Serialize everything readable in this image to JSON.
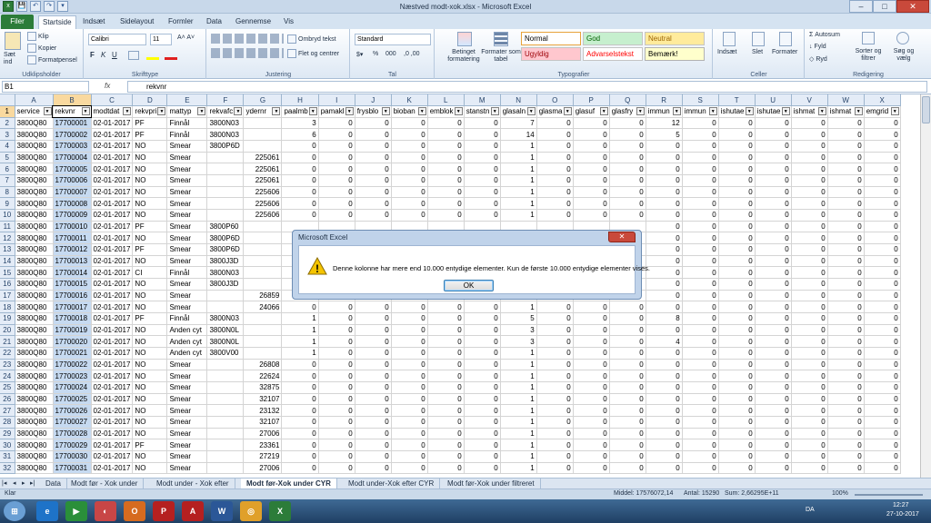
{
  "window": {
    "title": "Næstved modt-xok.xlsx - Microsoft Excel",
    "qat": [
      "x",
      "💾",
      "↶",
      "↷",
      "▾"
    ],
    "controls": {
      "minimize": "–",
      "maximize": "□",
      "close": "✕"
    }
  },
  "ribbon_tabs": {
    "file": "Filer",
    "tabs": [
      "Startside",
      "Indsæt",
      "Sidelayout",
      "Formler",
      "Data",
      "Gennemse",
      "Vis"
    ]
  },
  "ribbon": {
    "clipboard": {
      "paste": "Sæt ind",
      "cut": "Klip",
      "copy": "Kopier",
      "format_painter": "Formatpensel",
      "label": "Udklipsholder"
    },
    "font": {
      "name": "Calibri",
      "size": "11",
      "label": "Skrifttype",
      "bold": "F",
      "italic": "K",
      "underline": "U"
    },
    "alignment": {
      "wrap": "Ombryd tekst",
      "merge": "Flet og centrer",
      "label": "Justering"
    },
    "number": {
      "format": "Standard",
      "label": "Tal",
      "percent": "%",
      "thousands": "000"
    },
    "styles": {
      "cond_format": "Betinget formatering",
      "table_format": "Formater som tabel",
      "normal": "Normal",
      "good": "God",
      "neutral": "Neutral",
      "bad": "Ugyldig",
      "warning": "Advarselstekst",
      "note": "Bemærk!",
      "label": "Typografier"
    },
    "cells": {
      "insert": "Indsæt",
      "delete": "Slet",
      "format": "Formater",
      "label": "Celler"
    },
    "editing": {
      "autosum": "Autosum",
      "fill": "Fyld",
      "clear": "Ryd",
      "sort": "Sorter og filtrer",
      "find": "Søg og vælg",
      "label": "Redigering"
    }
  },
  "formula_bar": {
    "name_box": "B1",
    "fx": "fx",
    "content": "rekvnr"
  },
  "grid": {
    "columns": [
      "A",
      "B",
      "C",
      "D",
      "E",
      "F",
      "G",
      "H",
      "I",
      "J",
      "K",
      "L",
      "M",
      "N",
      "O",
      "P",
      "Q",
      "R",
      "S",
      "T",
      "U",
      "V",
      "W",
      "X"
    ],
    "header_row": [
      "service",
      "rekvnr",
      "modtdat",
      "rekvpri",
      "mattyp",
      "rekvafc",
      "ydernr",
      "paalmb",
      "pamakl",
      "frysblo",
      "bioban",
      "emblok",
      "stanstn",
      "glasaln",
      "glasma",
      "glasuf",
      "glasfry",
      "immun",
      "immun",
      "ishutae",
      "ishutae",
      "ishmat",
      "ishmat",
      "emgrid"
    ],
    "rows": [
      [
        "3800Q80",
        "17700001",
        "02-01-2017",
        "PF",
        "Finnål",
        "3800N03",
        "",
        "3",
        "0",
        "0",
        "0",
        "0",
        "0",
        "7",
        "0",
        "0",
        "0",
        "12",
        "0",
        "0",
        "0",
        "0",
        "0",
        "0"
      ],
      [
        "3800Q80",
        "17700002",
        "02-01-2017",
        "PF",
        "Finnål",
        "3800N03",
        "",
        "6",
        "0",
        "0",
        "0",
        "0",
        "0",
        "14",
        "0",
        "0",
        "0",
        "5",
        "0",
        "0",
        "0",
        "0",
        "0",
        "0"
      ],
      [
        "3800Q80",
        "17700003",
        "02-01-2017",
        "NO",
        "Smear",
        "3800P6D",
        "",
        "0",
        "0",
        "0",
        "0",
        "0",
        "0",
        "1",
        "0",
        "0",
        "0",
        "0",
        "0",
        "0",
        "0",
        "0",
        "0",
        "0"
      ],
      [
        "3800Q80",
        "17700004",
        "02-01-2017",
        "NO",
        "Smear",
        "",
        "225061",
        "0",
        "0",
        "0",
        "0",
        "0",
        "0",
        "1",
        "0",
        "0",
        "0",
        "0",
        "0",
        "0",
        "0",
        "0",
        "0",
        "0"
      ],
      [
        "3800Q80",
        "17700005",
        "02-01-2017",
        "NO",
        "Smear",
        "",
        "225061",
        "0",
        "0",
        "0",
        "0",
        "0",
        "0",
        "1",
        "0",
        "0",
        "0",
        "0",
        "0",
        "0",
        "0",
        "0",
        "0",
        "0"
      ],
      [
        "3800Q80",
        "17700006",
        "02-01-2017",
        "NO",
        "Smear",
        "",
        "225061",
        "0",
        "0",
        "0",
        "0",
        "0",
        "0",
        "1",
        "0",
        "0",
        "0",
        "0",
        "0",
        "0",
        "0",
        "0",
        "0",
        "0"
      ],
      [
        "3800Q80",
        "17700007",
        "02-01-2017",
        "NO",
        "Smear",
        "",
        "225606",
        "0",
        "0",
        "0",
        "0",
        "0",
        "0",
        "1",
        "0",
        "0",
        "0",
        "0",
        "0",
        "0",
        "0",
        "0",
        "0",
        "0"
      ],
      [
        "3800Q80",
        "17700008",
        "02-01-2017",
        "NO",
        "Smear",
        "",
        "225606",
        "0",
        "0",
        "0",
        "0",
        "0",
        "0",
        "1",
        "0",
        "0",
        "0",
        "0",
        "0",
        "0",
        "0",
        "0",
        "0",
        "0"
      ],
      [
        "3800Q80",
        "17700009",
        "02-01-2017",
        "NO",
        "Smear",
        "",
        "225606",
        "0",
        "0",
        "0",
        "0",
        "0",
        "0",
        "1",
        "0",
        "0",
        "0",
        "0",
        "0",
        "0",
        "0",
        "0",
        "0",
        "0"
      ],
      [
        "3800Q80",
        "17700010",
        "02-01-2017",
        "PF",
        "Smear",
        "3800P60",
        "",
        "",
        "",
        "",
        "",
        "",
        "",
        "",
        "",
        "",
        "",
        "0",
        "0",
        "0",
        "0",
        "0",
        "0",
        "0"
      ],
      [
        "3800Q80",
        "17700011",
        "02-01-2017",
        "NO",
        "Smear",
        "3800P6D",
        "",
        "",
        "",
        "",
        "",
        "",
        "",
        "",
        "",
        "",
        "",
        "0",
        "0",
        "0",
        "0",
        "0",
        "0",
        "0"
      ],
      [
        "3800Q80",
        "17700012",
        "02-01-2017",
        "PF",
        "Smear",
        "3800P6D",
        "",
        "",
        "",
        "",
        "",
        "",
        "",
        "",
        "",
        "",
        "",
        "0",
        "0",
        "0",
        "0",
        "0",
        "0",
        "0"
      ],
      [
        "3800Q80",
        "17700013",
        "02-01-2017",
        "NO",
        "Smear",
        "3800J3D",
        "",
        "",
        "",
        "",
        "",
        "",
        "",
        "",
        "",
        "",
        "",
        "0",
        "0",
        "0",
        "0",
        "0",
        "0",
        "0"
      ],
      [
        "3800Q80",
        "17700014",
        "02-01-2017",
        "CI",
        "Finnål",
        "3800N03",
        "",
        "",
        "",
        "",
        "",
        "",
        "",
        "",
        "",
        "",
        "",
        "0",
        "0",
        "0",
        "0",
        "0",
        "0",
        "0"
      ],
      [
        "3800Q80",
        "17700015",
        "02-01-2017",
        "NO",
        "Smear",
        "3800J3D",
        "",
        "",
        "",
        "",
        "",
        "",
        "",
        "",
        "",
        "",
        "",
        "0",
        "0",
        "0",
        "0",
        "0",
        "0",
        "0"
      ],
      [
        "3800Q80",
        "17700016",
        "02-01-2017",
        "NO",
        "Smear",
        "",
        "26859",
        "",
        "",
        "",
        "",
        "",
        "",
        "",
        "",
        "",
        "",
        "0",
        "0",
        "0",
        "0",
        "0",
        "0",
        "0"
      ],
      [
        "3800Q80",
        "17700017",
        "02-01-2017",
        "NO",
        "Smear",
        "",
        "24066",
        "0",
        "0",
        "0",
        "0",
        "0",
        "0",
        "1",
        "0",
        "0",
        "0",
        "0",
        "0",
        "0",
        "0",
        "0",
        "0",
        "0"
      ],
      [
        "3800Q80",
        "17700018",
        "02-01-2017",
        "PF",
        "Finnål",
        "3800N03",
        "",
        "1",
        "0",
        "0",
        "0",
        "0",
        "0",
        "5",
        "0",
        "0",
        "0",
        "8",
        "0",
        "0",
        "0",
        "0",
        "0",
        "0"
      ],
      [
        "3800Q80",
        "17700019",
        "02-01-2017",
        "NO",
        "Anden cyt",
        "3800N0L",
        "",
        "1",
        "0",
        "0",
        "0",
        "0",
        "0",
        "3",
        "0",
        "0",
        "0",
        "0",
        "0",
        "0",
        "0",
        "0",
        "0",
        "0"
      ],
      [
        "3800Q80",
        "17700020",
        "02-01-2017",
        "NO",
        "Anden cyt",
        "3800N0L",
        "",
        "1",
        "0",
        "0",
        "0",
        "0",
        "0",
        "3",
        "0",
        "0",
        "0",
        "4",
        "0",
        "0",
        "0",
        "0",
        "0",
        "0"
      ],
      [
        "3800Q80",
        "17700021",
        "02-01-2017",
        "NO",
        "Anden cyt",
        "3800V00",
        "",
        "1",
        "0",
        "0",
        "0",
        "0",
        "0",
        "1",
        "0",
        "0",
        "0",
        "0",
        "0",
        "0",
        "0",
        "0",
        "0",
        "0"
      ],
      [
        "3800Q80",
        "17700022",
        "02-01-2017",
        "NO",
        "Smear",
        "",
        "26808",
        "0",
        "0",
        "0",
        "0",
        "0",
        "0",
        "1",
        "0",
        "0",
        "0",
        "0",
        "0",
        "0",
        "0",
        "0",
        "0",
        "0"
      ],
      [
        "3800Q80",
        "17700023",
        "02-01-2017",
        "NO",
        "Smear",
        "",
        "22624",
        "0",
        "0",
        "0",
        "0",
        "0",
        "0",
        "1",
        "0",
        "0",
        "0",
        "0",
        "0",
        "0",
        "0",
        "0",
        "0",
        "0"
      ],
      [
        "3800Q80",
        "17700024",
        "02-01-2017",
        "NO",
        "Smear",
        "",
        "32875",
        "0",
        "0",
        "0",
        "0",
        "0",
        "0",
        "1",
        "0",
        "0",
        "0",
        "0",
        "0",
        "0",
        "0",
        "0",
        "0",
        "0"
      ],
      [
        "3800Q80",
        "17700025",
        "02-01-2017",
        "NO",
        "Smear",
        "",
        "32107",
        "0",
        "0",
        "0",
        "0",
        "0",
        "0",
        "1",
        "0",
        "0",
        "0",
        "0",
        "0",
        "0",
        "0",
        "0",
        "0",
        "0"
      ],
      [
        "3800Q80",
        "17700026",
        "02-01-2017",
        "NO",
        "Smear",
        "",
        "23132",
        "0",
        "0",
        "0",
        "0",
        "0",
        "0",
        "1",
        "0",
        "0",
        "0",
        "0",
        "0",
        "0",
        "0",
        "0",
        "0",
        "0"
      ],
      [
        "3800Q80",
        "17700027",
        "02-01-2017",
        "NO",
        "Smear",
        "",
        "32107",
        "0",
        "0",
        "0",
        "0",
        "0",
        "0",
        "1",
        "0",
        "0",
        "0",
        "0",
        "0",
        "0",
        "0",
        "0",
        "0",
        "0"
      ],
      [
        "3800Q80",
        "17700028",
        "02-01-2017",
        "NO",
        "Smear",
        "",
        "27006",
        "0",
        "0",
        "0",
        "0",
        "0",
        "0",
        "1",
        "0",
        "0",
        "0",
        "0",
        "0",
        "0",
        "0",
        "0",
        "0",
        "0"
      ],
      [
        "3800Q80",
        "17700029",
        "02-01-2017",
        "PF",
        "Smear",
        "",
        "23361",
        "0",
        "0",
        "0",
        "0",
        "0",
        "0",
        "1",
        "0",
        "0",
        "0",
        "0",
        "0",
        "0",
        "0",
        "0",
        "0",
        "0"
      ],
      [
        "3800Q80",
        "17700030",
        "02-01-2017",
        "NO",
        "Smear",
        "",
        "27219",
        "0",
        "0",
        "0",
        "0",
        "0",
        "0",
        "1",
        "0",
        "0",
        "0",
        "0",
        "0",
        "0",
        "0",
        "0",
        "0",
        "0"
      ],
      [
        "3800Q80",
        "17700031",
        "02-01-2017",
        "NO",
        "Smear",
        "",
        "27006",
        "0",
        "0",
        "0",
        "0",
        "0",
        "0",
        "1",
        "0",
        "0",
        "0",
        "0",
        "0",
        "0",
        "0",
        "0",
        "0",
        "0"
      ]
    ]
  },
  "sheets": {
    "nav": [
      "|◂",
      "◂",
      "▸",
      "▸|"
    ],
    "tabs": [
      "Data",
      "Modt før - Xok under",
      "Modt under - Xok efter",
      "Modt før-Xok under CYR",
      "Modt under-Xok efter CYR",
      "Modt før-Xok under filtreret"
    ],
    "active": 3
  },
  "status": {
    "left": "Klar",
    "average": "Middel: 17576072,14",
    "count": "Antal: 15290",
    "sum": "Sum: 2,66295E+11",
    "zoom": "100%"
  },
  "taskbar": {
    "lang": "DA",
    "time": "12:27",
    "date": "27-10-2017",
    "apps": [
      "e",
      "▶",
      "◐",
      "O",
      "P",
      "A",
      "W",
      "◎",
      "X"
    ]
  },
  "dialog": {
    "title": "Microsoft Excel",
    "message": "Denne kolonne har mere end 10.000 entydige elementer. Kun de første 10.000 entydige elementer vises.",
    "ok": "OK",
    "close": "✕",
    "warning_icon": "!"
  },
  "colors": {
    "excel_green": "#2c7c39",
    "selection": "#c6daf1",
    "header_selected": "#f9d99f"
  }
}
